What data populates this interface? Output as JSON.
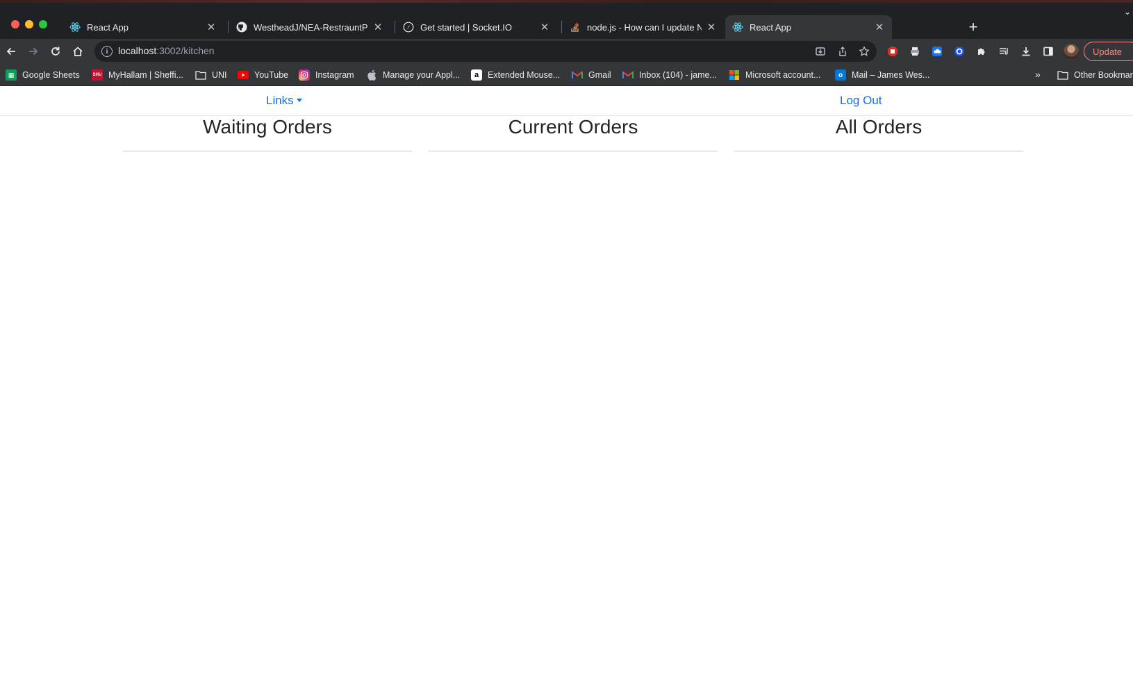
{
  "browser": {
    "tabs": [
      {
        "title": "React App",
        "icon": "react-icon"
      },
      {
        "title": "WestheadJ/NEA-RestrauntPOS",
        "icon": "github-icon"
      },
      {
        "title": "Get started | Socket.IO",
        "icon": "socketio-icon"
      },
      {
        "title": "node.js - How can I update Nod",
        "icon": "stackoverflow-icon"
      },
      {
        "title": "React App",
        "icon": "react-icon"
      }
    ],
    "address": {
      "host": "localhost",
      "rest": ":3002/kitchen"
    },
    "update_label": "Update",
    "bookmarks": [
      "Google Sheets",
      "MyHallam | Sheffi...",
      "UNI",
      "YouTube",
      "Instagram",
      "Manage your Appl...",
      "Extended Mouse...",
      "Gmail",
      "Inbox (104) - jame...",
      "Microsoft account...",
      "Mail – James Wes..."
    ],
    "other_bookmarks": "Other Bookmarks",
    "more_symbol": "»"
  },
  "page": {
    "nav": {
      "links_label": "Links",
      "logout_label": "Log Out"
    },
    "columns": [
      "Waiting Orders",
      "Current Orders",
      "All Orders"
    ]
  },
  "colors": {
    "link": "#0d6efd",
    "chrome_bg": "#202124",
    "toolbar_bg": "#35363a"
  }
}
